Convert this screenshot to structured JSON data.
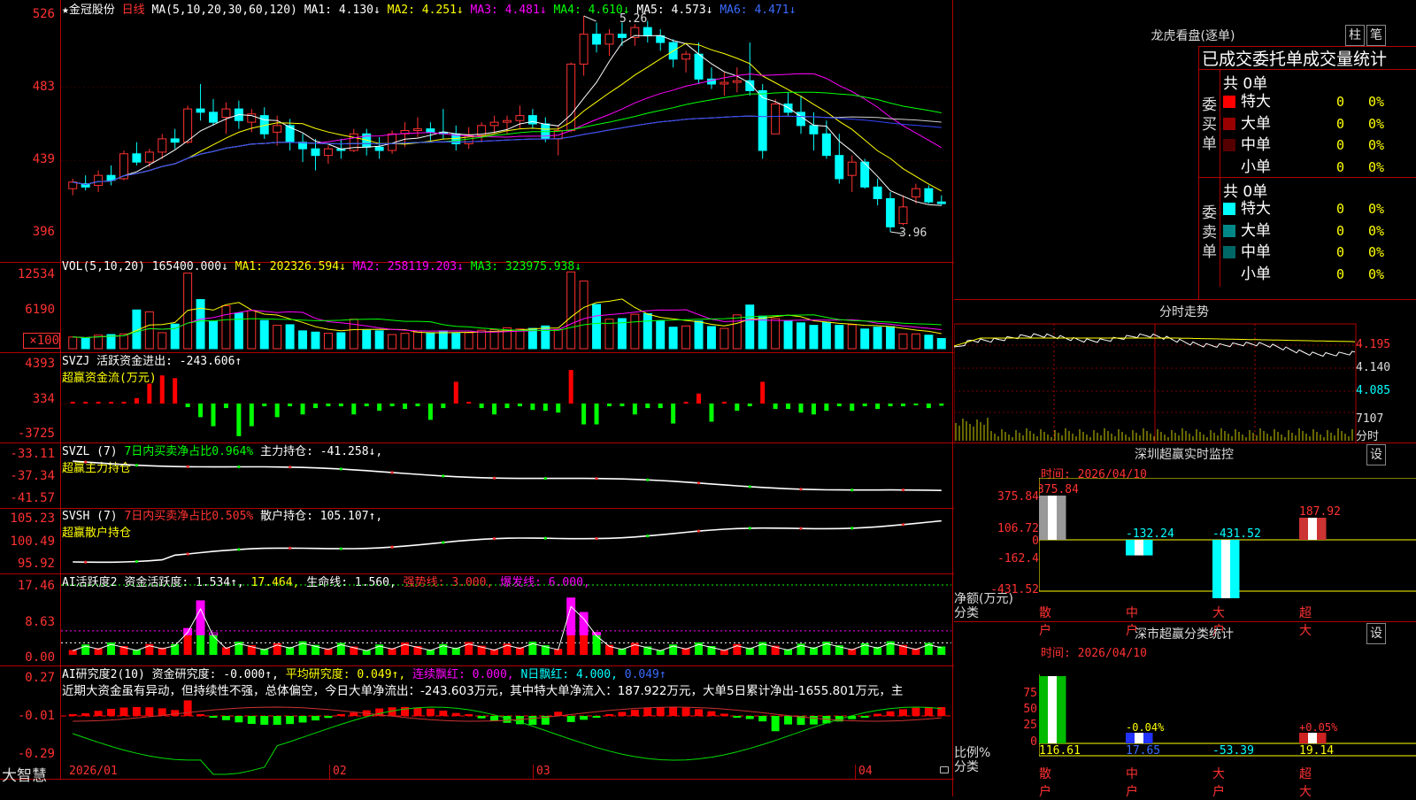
{
  "stock": {
    "name": "★金冠股份",
    "period": "日线",
    "ma_label": "MA(5,10,20,30,60,120)",
    "ma1": "MA1: 4.130↓",
    "ma2": "MA2: 4.251↓",
    "ma3": "MA3: 4.481↓",
    "ma4": "MA4: 4.610↓",
    "ma5": "MA5: 4.573↓",
    "ma6": "MA6: 4.471↓",
    "high_label": "5.26",
    "low_label": "3.96",
    "y_ticks": [
      "526",
      "483",
      "439",
      "396"
    ]
  },
  "vol": {
    "title": "VOL(5,10,20)",
    "value": "165400.000↓",
    "ma1": "MA1: 202326.594↓",
    "ma2": "MA2: 258119.203↓",
    "ma3": "MA3: 323975.938↓",
    "y_ticks": [
      "12534",
      "6190",
      "×100"
    ]
  },
  "svzj": {
    "title": "SVZJ  活跃资金进出: -243.606↑",
    "subtitle": "超赢资金流(万元)",
    "y_ticks": [
      "4393",
      "334",
      "-3725"
    ]
  },
  "svzl": {
    "title": "SVZL (7)",
    "ratio": "7日内买卖净占比0.964%",
    "hold": "主力持仓: -41.258↓,",
    "subtitle": "超赢主力持仓",
    "y_ticks": [
      "-33.11",
      "-37.34",
      "-41.57"
    ]
  },
  "svsh": {
    "title": "SVSH (7)",
    "ratio": "7日内买卖净占比0.505%",
    "hold": "散户持仓: 105.107↑,",
    "subtitle": "超赢散户持仓",
    "y_ticks": [
      "105.23",
      "100.49",
      "95.92"
    ]
  },
  "ai1": {
    "title": "AI活跃度2",
    "p1": "资金活跃度: 1.534↑,",
    "p2": "17.464,",
    "p3": "生命线: 1.560,",
    "p4": "强势线: 3.000,",
    "p5": "爆发线: 6.000,",
    "y_ticks": [
      "17.46",
      "8.63",
      "0.00"
    ]
  },
  "ai2": {
    "title": "AI研究度2(10)",
    "p1": "资金研究度: -0.000↑,",
    "p2": "平均研究度: 0.049↑,",
    "p3": "连续飘红: 0.000,",
    "p4": "N日飘红: 4.000,",
    "p5": "0.049↑",
    "commentary": "近期大资金虽有异动，但持续性不强，总体偏空，今日大单净流出：-243.603万元，其中特大单净流入：187.922万元，大单5日累计净出-1655.801万元，主",
    "y_ticks": [
      "0.27",
      "-0.01",
      "-0.29"
    ]
  },
  "xaxis": {
    "labels": [
      "2026/01",
      "02",
      "03",
      "04"
    ],
    "brand": "大智慧"
  },
  "longhu": {
    "title": "龙虎看盘(逐单)",
    "btn1": "柱",
    "btn2": "笔",
    "header": "已成交委托单成交量统计",
    "buy_label": "委买单",
    "sell_label": "委卖单",
    "buy_total": "共 0单",
    "sell_total": "共 0单",
    "buy_rows": [
      {
        "label": "特大",
        "count": "0",
        "pct": "0%",
        "color": "#ff0000"
      },
      {
        "label": "大单",
        "count": "0",
        "pct": "0%",
        "color": "#990000"
      },
      {
        "label": "中单",
        "count": "0",
        "pct": "0%",
        "color": "#550000"
      },
      {
        "label": "小单",
        "count": "0",
        "pct": "0%",
        "color": "#000000"
      }
    ],
    "sell_rows": [
      {
        "label": "特大",
        "count": "0",
        "pct": "0%",
        "color": "#00ffff"
      },
      {
        "label": "大单",
        "count": "0",
        "pct": "0%",
        "color": "#008888"
      },
      {
        "label": "中单",
        "count": "0",
        "pct": "0%",
        "color": "#006666"
      },
      {
        "label": "小单",
        "count": "0",
        "pct": "0%",
        "color": "#000000"
      }
    ]
  },
  "fenshi": {
    "title": "分时走势",
    "y_ticks": [
      "4.195",
      "4.140",
      "4.085"
    ],
    "vol_tick": "7107",
    "vol_label": "分时"
  },
  "monitor": {
    "title": "深圳超赢实时监控",
    "btn": "设",
    "time": "时间: 2026/04/10",
    "ylabel1": "净额(万元)",
    "ylabel2": "分类",
    "y_ticks": [
      "375.84",
      "106.72",
      "0",
      "-162.4",
      "-431.52"
    ],
    "categories": [
      "散户",
      "中户",
      "大户",
      "超大"
    ],
    "value_labels": [
      "375.84",
      "-132.24",
      "-431.52",
      "187.92"
    ]
  },
  "classify": {
    "title": "深市超赢分类统计",
    "btn": "设",
    "time": "时间: 2026/04/10",
    "ylabel1": "比例%",
    "ylabel2": "分类",
    "y_ticks": [
      "75",
      "50",
      "25",
      "0"
    ],
    "categories": [
      "散户",
      "中户",
      "大户",
      "超大"
    ],
    "pct_labels": [
      "",
      "-0.04%",
      "",
      "+0.05%"
    ],
    "value_labels": [
      "116.61",
      "17.65",
      "-53.39",
      "19.14"
    ]
  },
  "chart_data": [
    {
      "type": "candlestick",
      "title": "金冠股份 日线",
      "x": [
        "2026/01",
        "02",
        "03",
        "04"
      ],
      "ylim": [
        3.96,
        5.26
      ],
      "candles": [
        [
          4.22,
          4.28,
          4.18,
          4.26
        ],
        [
          4.25,
          4.3,
          4.21,
          4.23
        ],
        [
          4.24,
          4.33,
          4.2,
          4.3
        ],
        [
          4.3,
          4.36,
          4.24,
          4.27
        ],
        [
          4.28,
          4.45,
          4.27,
          4.43
        ],
        [
          4.43,
          4.5,
          4.36,
          4.38
        ],
        [
          4.38,
          4.46,
          4.35,
          4.44
        ],
        [
          4.44,
          4.55,
          4.4,
          4.52
        ],
        [
          4.52,
          4.58,
          4.46,
          4.5
        ],
        [
          4.5,
          4.72,
          4.49,
          4.7
        ],
        [
          4.7,
          4.85,
          4.63,
          4.68
        ],
        [
          4.68,
          4.76,
          4.6,
          4.62
        ],
        [
          4.65,
          4.74,
          4.55,
          4.7
        ],
        [
          4.7,
          4.75,
          4.58,
          4.63
        ],
        [
          4.62,
          4.7,
          4.56,
          4.67
        ],
        [
          4.66,
          4.71,
          4.52,
          4.55
        ],
        [
          4.56,
          4.66,
          4.48,
          4.6
        ],
        [
          4.6,
          4.64,
          4.45,
          4.5
        ],
        [
          4.5,
          4.55,
          4.38,
          4.46
        ],
        [
          4.46,
          4.52,
          4.33,
          4.42
        ],
        [
          4.42,
          4.48,
          4.37,
          4.46
        ],
        [
          4.46,
          4.52,
          4.4,
          4.45
        ],
        [
          4.45,
          4.58,
          4.44,
          4.55
        ],
        [
          4.55,
          4.58,
          4.42,
          4.47
        ],
        [
          4.47,
          4.53,
          4.4,
          4.45
        ],
        [
          4.45,
          4.57,
          4.43,
          4.55
        ],
        [
          4.55,
          4.62,
          4.47,
          4.57
        ],
        [
          4.57,
          4.65,
          4.53,
          4.58
        ],
        [
          4.58,
          4.62,
          4.5,
          4.56
        ],
        [
          4.56,
          4.7,
          4.52,
          4.55
        ],
        [
          4.55,
          4.6,
          4.45,
          4.49
        ],
        [
          4.49,
          4.59,
          4.46,
          4.54
        ],
        [
          4.54,
          4.62,
          4.5,
          4.6
        ],
        [
          4.6,
          4.66,
          4.55,
          4.62
        ],
        [
          4.62,
          4.66,
          4.55,
          4.63
        ],
        [
          4.63,
          4.72,
          4.58,
          4.66
        ],
        [
          4.66,
          4.7,
          4.58,
          4.61
        ],
        [
          4.61,
          4.65,
          4.5,
          4.52
        ],
        [
          4.52,
          4.6,
          4.42,
          4.57
        ],
        [
          4.57,
          4.98,
          4.56,
          4.97
        ],
        [
          4.97,
          5.26,
          4.9,
          5.15
        ],
        [
          5.15,
          5.22,
          5.04,
          5.09
        ],
        [
          5.09,
          5.18,
          5.02,
          5.15
        ],
        [
          5.15,
          5.22,
          5.08,
          5.13
        ],
        [
          5.13,
          5.21,
          5.08,
          5.19
        ],
        [
          5.19,
          5.23,
          5.1,
          5.14
        ],
        [
          5.14,
          5.18,
          5.05,
          5.1
        ],
        [
          5.1,
          5.12,
          4.95,
          5.0
        ],
        [
          5.0,
          5.05,
          4.92,
          5.03
        ],
        [
          5.03,
          5.1,
          4.85,
          4.88
        ],
        [
          4.88,
          4.95,
          4.82,
          4.85
        ],
        [
          4.85,
          4.92,
          4.78,
          4.86
        ],
        [
          4.86,
          4.95,
          4.8,
          4.87
        ],
        [
          4.87,
          5.1,
          4.78,
          4.81
        ],
        [
          4.81,
          4.85,
          4.4,
          4.45
        ],
        [
          4.55,
          4.76,
          4.55,
          4.73
        ],
        [
          4.73,
          4.8,
          4.66,
          4.68
        ],
        [
          4.68,
          4.78,
          4.55,
          4.6
        ],
        [
          4.6,
          4.68,
          4.45,
          4.55
        ],
        [
          4.55,
          4.63,
          4.4,
          4.42
        ],
        [
          4.42,
          4.55,
          4.25,
          4.28
        ],
        [
          4.3,
          4.42,
          4.2,
          4.38
        ],
        [
          4.38,
          4.4,
          4.22,
          4.23
        ],
        [
          4.23,
          4.28,
          4.12,
          4.16
        ],
        [
          4.16,
          4.2,
          3.96,
          3.99
        ],
        [
          4.01,
          4.18,
          4.0,
          4.11
        ],
        [
          4.17,
          4.25,
          4.13,
          4.22
        ],
        [
          4.22,
          4.24,
          4.13,
          4.14
        ],
        [
          4.14,
          4.18,
          4.12,
          4.13
        ]
      ]
    },
    {
      "type": "bar",
      "title": "VOL",
      "values": [
        1900,
        1700,
        2200,
        2300,
        2400,
        6300,
        6000,
        2600,
        4000,
        12300,
        8000,
        4500,
        7000,
        5800,
        6200,
        4600,
        3800,
        3900,
        2900,
        2700,
        2500,
        2600,
        4800,
        3000,
        2900,
        2300,
        2500,
        2700,
        2600,
        2900,
        2500,
        2600,
        3000,
        3100,
        3400,
        3200,
        3300,
        3700,
        3100,
        12500,
        11000,
        7200,
        4800,
        4900,
        5600,
        5700,
        4500,
        3500,
        3700,
        4500,
        3600,
        3300,
        5500,
        7100,
        5300,
        4900,
        4500,
        4200,
        3800,
        4300,
        3800,
        3900,
        3200,
        3500,
        3600,
        2400,
        2400,
        2200,
        1654
      ]
    },
    {
      "type": "bar",
      "title": "超赢资金流(万元)",
      "values": [
        0,
        0,
        0,
        0,
        0,
        600,
        2200,
        3100,
        2800,
        -400,
        -1500,
        -2500,
        -500,
        -3600,
        -2500,
        -300,
        -1500,
        -300,
        -1200,
        -500,
        -300,
        -300,
        -1200,
        -300,
        -800,
        -300,
        -600,
        -300,
        -1800,
        -500,
        2400,
        0,
        -500,
        -1200,
        -500,
        -300,
        -700,
        -800,
        -1000,
        3700,
        -2300,
        -2300,
        -300,
        -300,
        -1200,
        -500,
        -500,
        -2200,
        0,
        1100,
        -2000,
        200,
        -800,
        -300,
        2400,
        -600,
        -600,
        -1000,
        -1200,
        -800,
        -300,
        -800,
        -300,
        -600,
        -300,
        -300,
        -200,
        -500,
        -243
      ]
    }
  ]
}
